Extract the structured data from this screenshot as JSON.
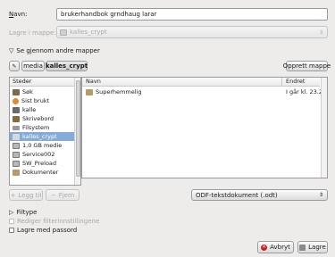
{
  "name": {
    "label": "Navn:",
    "value": "brukerhandbok grndhaug larar"
  },
  "save_in": {
    "label": "Lagre i mappe:",
    "value": "kalles_crypt"
  },
  "browse": {
    "label": "Se gjennom andre mapper"
  },
  "path": {
    "items": [
      "media",
      "kalles_crypt"
    ]
  },
  "create_folder": {
    "label": "Opprett mappe"
  },
  "places": {
    "header": "Steder",
    "items": [
      {
        "label": "Søk",
        "icon": "search-icon",
        "selected": false
      },
      {
        "label": "Sist brukt",
        "icon": "recent-icon",
        "selected": false
      },
      {
        "label": "kalle",
        "icon": "home-icon",
        "selected": false
      },
      {
        "label": "Skrivebord",
        "icon": "desktop-icon",
        "selected": false
      },
      {
        "label": "Filsystem",
        "icon": "drive-icon",
        "selected": false
      },
      {
        "label": "kalles_crypt",
        "icon": "drive-icon",
        "selected": true
      },
      {
        "label": "1,0 GB medie",
        "icon": "drive-icon",
        "selected": false
      },
      {
        "label": "Service002",
        "icon": "drive-icon",
        "selected": false
      },
      {
        "label": "SW_Preload",
        "icon": "drive-icon",
        "selected": false
      },
      {
        "label": "Dokumenter",
        "icon": "folder-icon",
        "selected": false
      }
    ]
  },
  "files": {
    "columns": [
      "Navn",
      "Endret"
    ],
    "rows": [
      {
        "name": "Superhemmelig",
        "modified": "I går kl. 23.24"
      }
    ]
  },
  "add_button": {
    "label": "Legg til"
  },
  "remove_button": {
    "label": "Fjern"
  },
  "file_type": {
    "value": "ODF-tekstdokument (.odt)"
  },
  "filetype_expander": {
    "label": "Filtype"
  },
  "edit_filter": {
    "label": "Rediger filterinnstillingene"
  },
  "password": {
    "label": "Lagre med passord"
  },
  "cancel_button": {
    "label": "Avbryt"
  },
  "save_button": {
    "label": "Lagre"
  },
  "colors": {
    "selection": "#86abd9",
    "cancel_icon": "#cc2020"
  }
}
